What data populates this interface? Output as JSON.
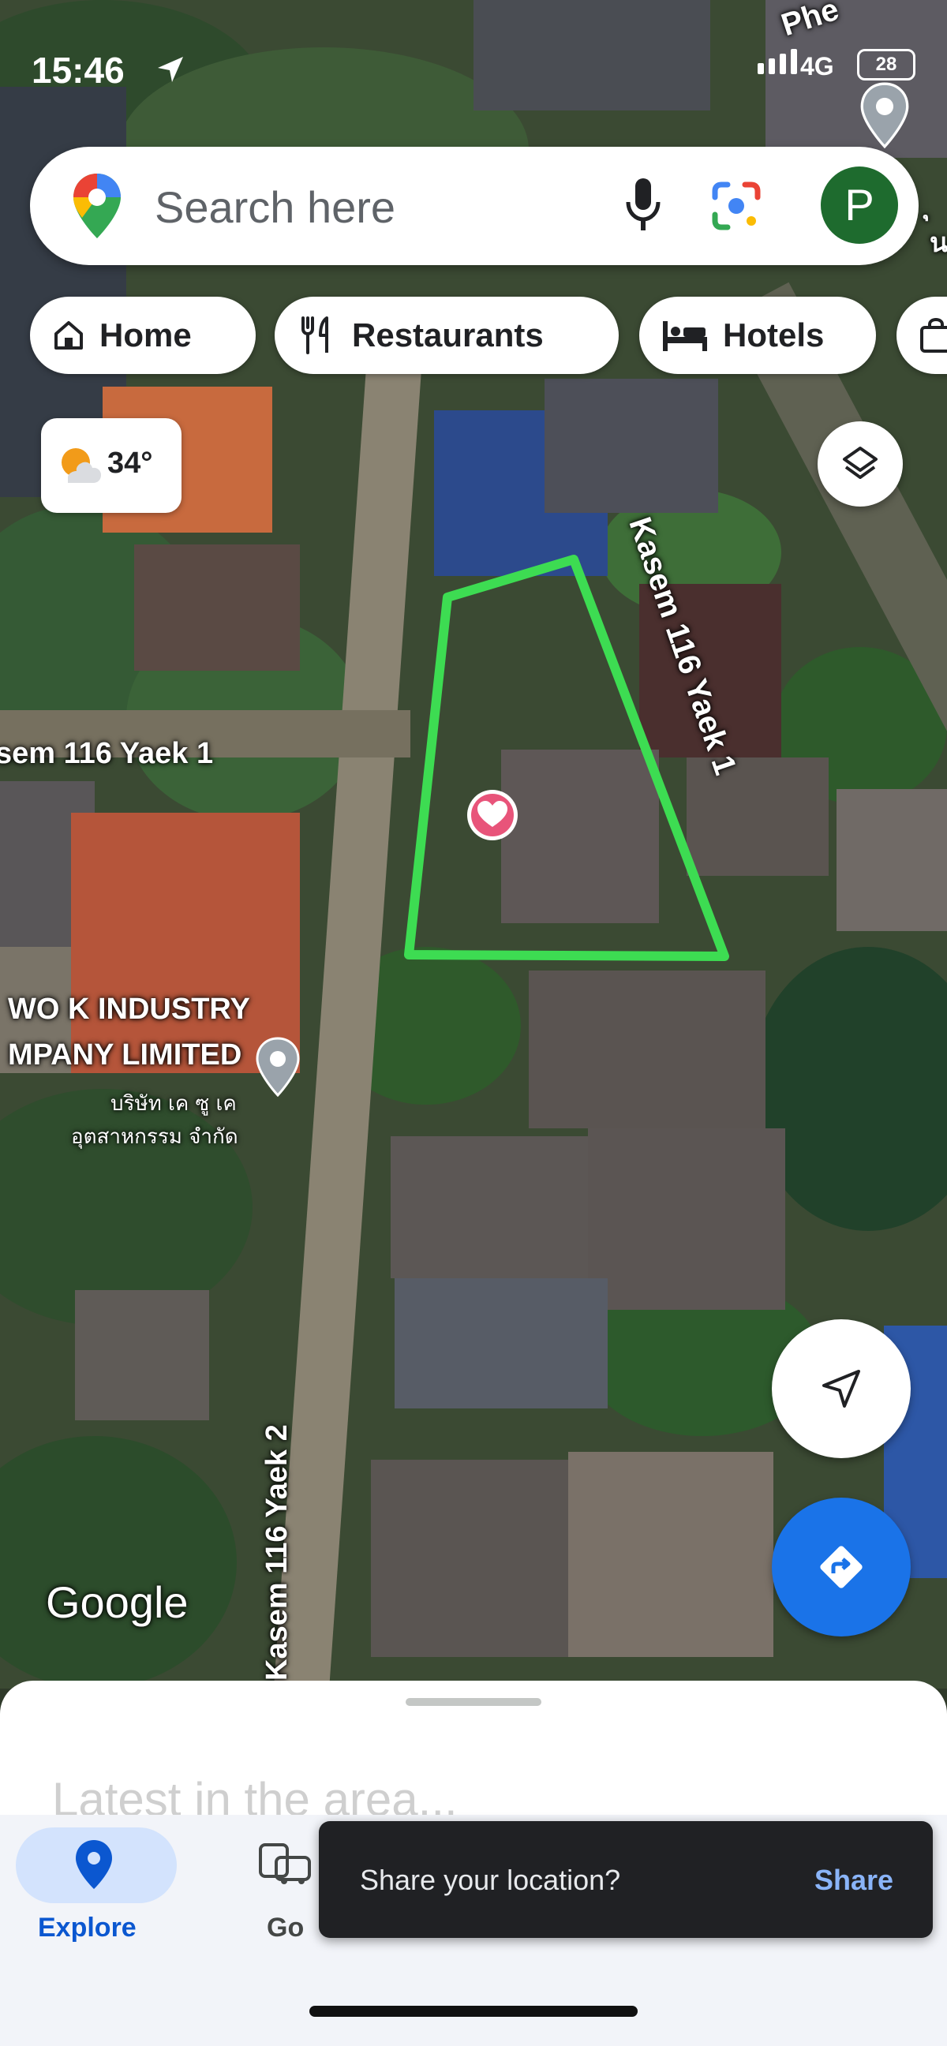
{
  "status": {
    "time": "15:46",
    "network": "4G",
    "battery": "28"
  },
  "search": {
    "placeholder": "Search here"
  },
  "user": {
    "avatar_letter": "P"
  },
  "chips": [
    {
      "label": "Home"
    },
    {
      "label": "Restaurants"
    },
    {
      "label": "Hotels"
    }
  ],
  "weather": {
    "temperature": "34°"
  },
  "map_labels": {
    "street_top": "Phe",
    "street_main_vertical": "Kasem 116 Yaek 1",
    "street_horizontal": "sem 116 Yaek 1",
    "street_lower_vertical": "Kasem 116 Yaek 2",
    "company_en_line1": "WO K INDUSTRY",
    "company_en_line2": "MPANY LIMITED",
    "company_th_line1": "บริษัท เค ซู เค",
    "company_th_line2": "อุตสาหกรรม จำกัด",
    "right_edge_char1": "ุ",
    "right_edge_char2": "น",
    "right_edge_char3": "ห",
    "attribution": "Google"
  },
  "bottom_sheet": {
    "heading": "Latest in the area..."
  },
  "nav": {
    "explore": "Explore",
    "go": "Go"
  },
  "snackbar": {
    "message": "Share your location?",
    "action": "Share"
  },
  "colors": {
    "parcel_outline": "#3ddc52",
    "accent_blue": "#1a73e8",
    "avatar_green": "#1e6b2e",
    "favorite_pink": "#e8547a"
  }
}
